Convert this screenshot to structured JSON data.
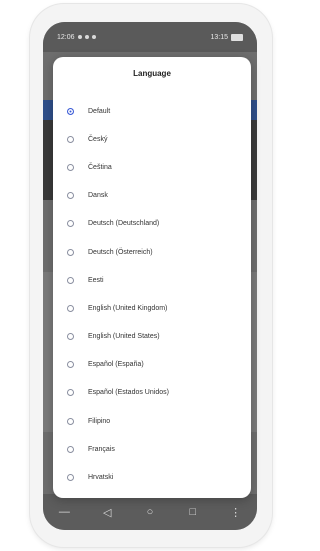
{
  "status_bar": {
    "time": "12:06",
    "right_text": "13:15"
  },
  "dialog": {
    "title": "Language",
    "selected_index": 0,
    "options": [
      {
        "label": "Default"
      },
      {
        "label": "Český"
      },
      {
        "label": "Čeština"
      },
      {
        "label": "Dansk"
      },
      {
        "label": "Deutsch (Deutschland)"
      },
      {
        "label": "Deutsch (Österreich)"
      },
      {
        "label": "Eesti"
      },
      {
        "label": "English (United Kingdom)"
      },
      {
        "label": "English (United States)"
      },
      {
        "label": "Español (España)"
      },
      {
        "label": "Español (Estados Unidos)"
      },
      {
        "label": "Filipino"
      },
      {
        "label": "Français"
      },
      {
        "label": "Hrvatski"
      }
    ]
  },
  "colors": {
    "accent": "#3b5bd6",
    "scrim": "#6e6e6e"
  },
  "nav_icons": [
    "minimize-icon",
    "back-icon",
    "home-icon",
    "recents-icon",
    "menu-icon"
  ]
}
